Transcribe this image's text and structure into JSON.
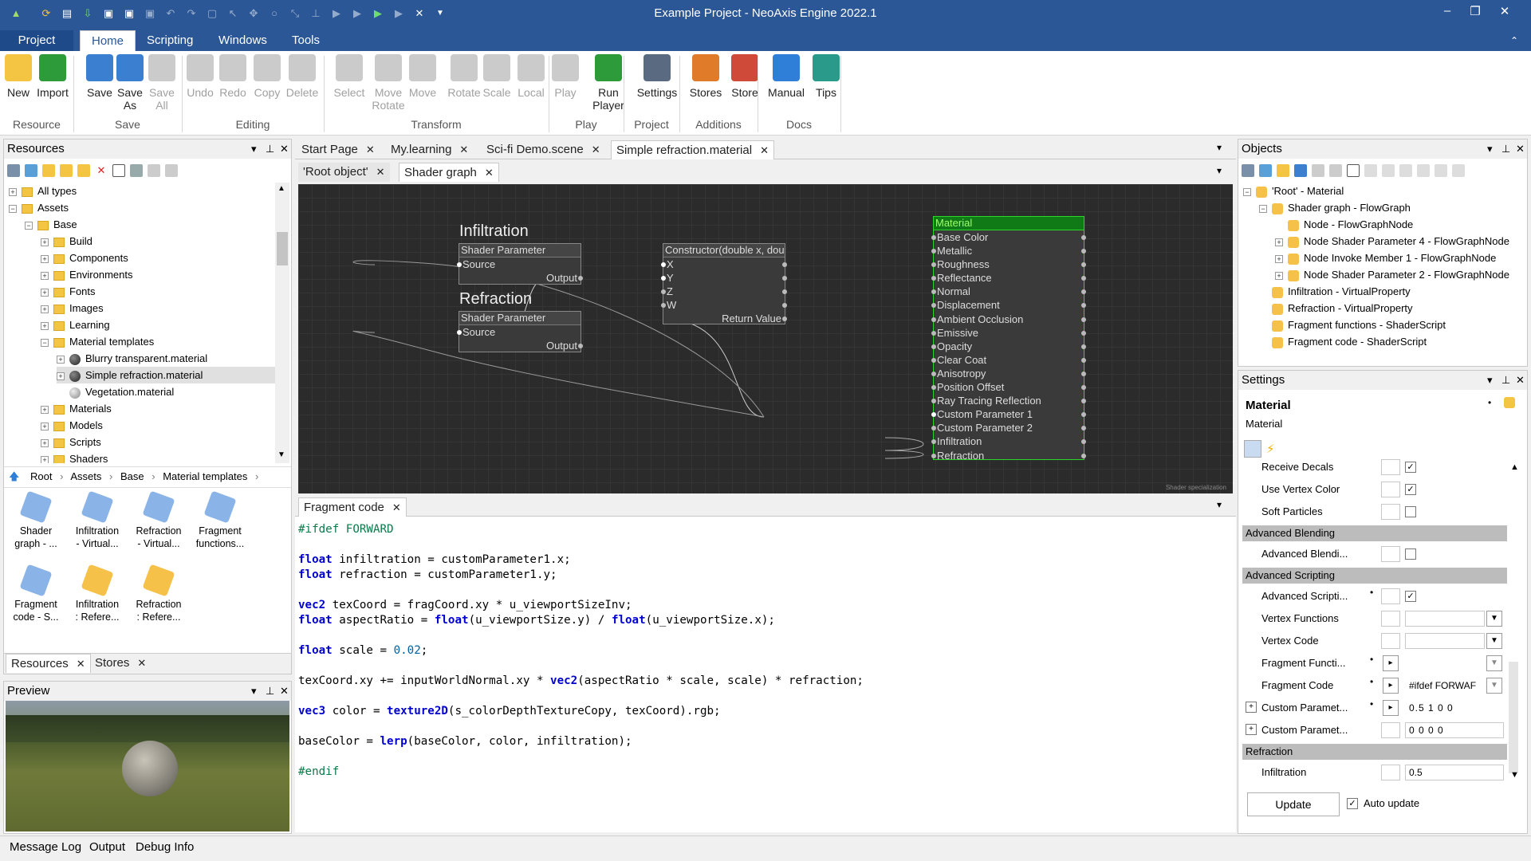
{
  "window": {
    "title": "Example Project - NeoAxis Engine 2022.1"
  },
  "menu_tabs": [
    "Project",
    "Home",
    "Scripting",
    "Windows",
    "Tools"
  ],
  "ribbon": {
    "buttons": [
      {
        "label": "New",
        "line2": "",
        "disabled": false,
        "color": "#f4c542"
      },
      {
        "label": "Import",
        "line2": "",
        "disabled": false,
        "color": "#2e9b3b"
      },
      {
        "label": "Save",
        "line2": "",
        "disabled": false,
        "color": "#3b7fd1"
      },
      {
        "label": "Save",
        "line2": "As",
        "disabled": false,
        "color": "#3b7fd1"
      },
      {
        "label": "Save",
        "line2": "All",
        "disabled": true,
        "color": "#8c8c8c"
      },
      {
        "label": "Undo",
        "line2": "",
        "disabled": true,
        "color": "#8c8c8c"
      },
      {
        "label": "Redo",
        "line2": "",
        "disabled": true,
        "color": "#8c8c8c"
      },
      {
        "label": "Copy",
        "line2": "",
        "disabled": true,
        "color": "#8c8c8c"
      },
      {
        "label": "Delete",
        "line2": "",
        "disabled": true,
        "color": "#8c8c8c"
      },
      {
        "label": "Select",
        "line2": "",
        "disabled": true,
        "color": "#8c8c8c"
      },
      {
        "label": "Move",
        "line2": "Rotate",
        "disabled": true,
        "color": "#8c8c8c"
      },
      {
        "label": "Move",
        "line2": "",
        "disabled": true,
        "color": "#8c8c8c"
      },
      {
        "label": "Rotate",
        "line2": "",
        "disabled": true,
        "color": "#8c8c8c"
      },
      {
        "label": "Scale",
        "line2": "",
        "disabled": true,
        "color": "#8c8c8c"
      },
      {
        "label": "Local",
        "line2": "",
        "disabled": true,
        "color": "#8c8c8c"
      },
      {
        "label": "Play",
        "line2": "",
        "disabled": true,
        "color": "#8c8c8c"
      },
      {
        "label": "Run",
        "line2": "Player",
        "disabled": false,
        "color": "#2e9b3b"
      },
      {
        "label": "Settings",
        "line2": "",
        "disabled": false,
        "color": "#5a6a80"
      },
      {
        "label": "Stores",
        "line2": "",
        "disabled": false,
        "color": "#e07b2a"
      },
      {
        "label": "Store",
        "line2": "",
        "disabled": false,
        "color": "#d04a3a"
      },
      {
        "label": "Manual",
        "line2": "",
        "disabled": false,
        "color": "#2f7fd8"
      },
      {
        "label": "Tips",
        "line2": "",
        "disabled": false,
        "color": "#2a9a8a"
      }
    ],
    "groups": [
      "Resource",
      "Save",
      "Editing",
      "Transform",
      "Play",
      "Project",
      "Additions",
      "Docs"
    ]
  },
  "resources": {
    "title": "Resources",
    "tree": [
      {
        "label": "All types",
        "exp": "+",
        "kind": "folder"
      },
      {
        "label": "Assets",
        "exp": "−",
        "kind": "folder"
      },
      {
        "label": "Base",
        "exp": "−",
        "kind": "folder"
      },
      {
        "label": "Build",
        "exp": "+",
        "kind": "folder"
      },
      {
        "label": "Components",
        "exp": "+",
        "kind": "folder"
      },
      {
        "label": "Environments",
        "exp": "+",
        "kind": "folder"
      },
      {
        "label": "Fonts",
        "exp": "+",
        "kind": "folder"
      },
      {
        "label": "Images",
        "exp": "+",
        "kind": "folder"
      },
      {
        "label": "Learning",
        "exp": "+",
        "kind": "folder"
      },
      {
        "label": "Material templates",
        "exp": "−",
        "kind": "folder"
      },
      {
        "label": "Blurry transparent.material",
        "exp": "+",
        "kind": "ball"
      },
      {
        "label": "Simple refraction.material",
        "exp": "+",
        "kind": "ball"
      },
      {
        "label": "Vegetation.material",
        "exp": "",
        "kind": "ball"
      },
      {
        "label": "Materials",
        "exp": "+",
        "kind": "folder"
      },
      {
        "label": "Models",
        "exp": "+",
        "kind": "folder"
      },
      {
        "label": "Scripts",
        "exp": "+",
        "kind": "folder"
      },
      {
        "label": "Shaders",
        "exp": "+",
        "kind": "folder"
      }
    ],
    "breadcrumb": [
      "Root",
      "Assets",
      "Base",
      "Material templates"
    ],
    "items": [
      {
        "line1": "Shader",
        "line2": "graph - ..."
      },
      {
        "line1": "Infiltration",
        "line2": "- Virtual..."
      },
      {
        "line1": "Refraction",
        "line2": "- Virtual..."
      },
      {
        "line1": "Fragment",
        "line2": "functions..."
      },
      {
        "line1": "Fragment",
        "line2": "code - S..."
      },
      {
        "line1": "Infiltration",
        "line2": ": Refere..."
      },
      {
        "line1": "Refraction",
        "line2": ": Refere..."
      }
    ],
    "bottom_tabs": [
      "Resources",
      "Stores"
    ]
  },
  "preview": {
    "title": "Preview"
  },
  "doc_tabs": [
    "Start Page",
    "My.learning",
    "Sci-fi Demo.scene",
    "Simple refraction.material"
  ],
  "sub_tabs": [
    "'Root object'",
    "Shader graph"
  ],
  "graph": {
    "infiltration_title": "Infiltration",
    "refraction_title": "Refraction",
    "shader_param": "Shader Parameter",
    "source": "Source",
    "output": "Output",
    "constructor_title": "Constructor(double x, double",
    "constructor_inputs": [
      "X",
      "Y",
      "Z",
      "W"
    ],
    "return_value": "Return Value",
    "material_title": "Material",
    "material_props": [
      "Base Color",
      "Metallic",
      "Roughness",
      "Reflectance",
      "Normal",
      "Displacement",
      "Ambient Occlusion",
      "Emissive",
      "Opacity",
      "Clear Coat",
      "Anisotropy",
      "Position Offset",
      "Ray Tracing Reflection",
      "Custom Parameter 1",
      "Custom Parameter 2",
      "Infiltration",
      "Refraction"
    ],
    "watermark": "Shader specialization"
  },
  "fragment": {
    "tab": "Fragment code",
    "lines": [
      "#ifdef FORWARD",
      "",
      "float infiltration = customParameter1.x;",
      "float refraction = customParameter1.y;",
      "",
      "vec2 texCoord = fragCoord.xy * u_viewportSizeInv;",
      "float aspectRatio = float(u_viewportSize.y) / float(u_viewportSize.x);",
      "",
      "float scale = 0.02;",
      "",
      "texCoord.xy += inputWorldNormal.xy * vec2(aspectRatio * scale, scale) * refraction;",
      "",
      "vec3 color = texture2D(s_colorDepthTextureCopy, texCoord).rgb;",
      "",
      "baseColor = lerp(baseColor, color, infiltration);",
      "",
      "#endif"
    ]
  },
  "objects": {
    "title": "Objects",
    "tree": [
      {
        "label": "'Root' - Material",
        "exp": "−",
        "indent": 0
      },
      {
        "label": "Shader graph - FlowGraph",
        "exp": "−",
        "indent": 1
      },
      {
        "label": "Node  - FlowGraphNode",
        "exp": "",
        "indent": 2
      },
      {
        "label": "Node Shader Parameter 4 - FlowGraphNode",
        "exp": "+",
        "indent": 2
      },
      {
        "label": "Node Invoke Member 1 - FlowGraphNode",
        "exp": "+",
        "indent": 2
      },
      {
        "label": "Node Shader Parameter 2 - FlowGraphNode",
        "exp": "+",
        "indent": 2
      },
      {
        "label": "Infiltration - VirtualProperty",
        "exp": "",
        "indent": 1
      },
      {
        "label": "Refraction - VirtualProperty",
        "exp": "",
        "indent": 1
      },
      {
        "label": "Fragment functions - ShaderScript",
        "exp": "",
        "indent": 1
      },
      {
        "label": "Fragment code - ShaderScript",
        "exp": "",
        "indent": 1
      }
    ]
  },
  "settings": {
    "title": "Settings",
    "object_name": "Material",
    "object_type": "Material",
    "receive_decals": "Receive Decals",
    "use_vertex_color": "Use Vertex Color",
    "soft_particles": "Soft Particles",
    "adv_blending_hdr": "Advanced Blending",
    "adv_blending": "Advanced Blendi...",
    "adv_scripting_hdr": "Advanced Scripting",
    "adv_scripting": "Advanced Scripti...",
    "vertex_functions": "Vertex Functions",
    "vertex_code": "Vertex Code",
    "fragment_functions": "Fragment Functi...",
    "fragment_code": "Fragment Code",
    "fragment_code_value": "#ifdef FORWAF",
    "custom_param1": "Custom Paramet...",
    "custom_param1_value": "0.5 1 0 0",
    "custom_param2": "Custom Paramet...",
    "custom_param2_value": "0 0 0 0",
    "refraction_hdr": "Refraction",
    "infiltration": "Infiltration",
    "infiltration_value": "0.5",
    "update_button": "Update",
    "auto_update": "Auto update"
  },
  "bottom_bar": [
    "Message Log",
    "Output",
    "Debug Info"
  ]
}
